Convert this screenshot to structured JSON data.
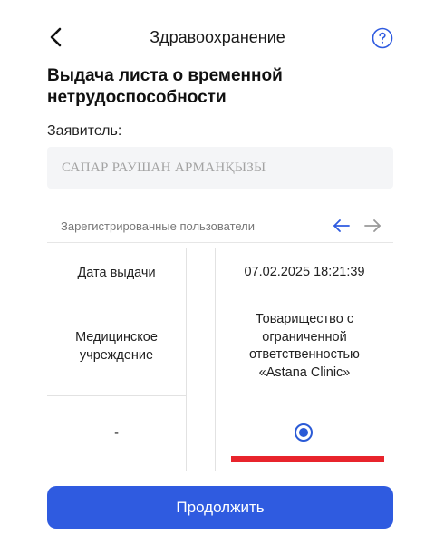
{
  "header": {
    "title": "Здравоохранение"
  },
  "page": {
    "title": "Выдача листа о временной нетрудоспособности"
  },
  "applicant": {
    "label": "Заявитель:",
    "value": "САПАР РАУШАН АРМАНҚЫЗЫ"
  },
  "registered_users": {
    "label": "Зарегистрированные пользователи"
  },
  "table": {
    "rows": [
      {
        "label": "Дата выдачи",
        "value": "07.02.2025 18:21:39"
      },
      {
        "label": "Медицинское учреждение",
        "value": "Товарищество с ограниченной ответственностью «Astana Clinic»"
      },
      {
        "label": "-",
        "value": ""
      }
    ],
    "selected": true
  },
  "actions": {
    "continue_label": "Продолжить"
  },
  "colors": {
    "accent": "#2f5be0",
    "radio": "#2a5ad6",
    "highlight_bar": "#e8242c",
    "field_bg": "#f4f5f7"
  },
  "icons": {
    "back": "chevron-left-icon",
    "help": "question-circle-icon",
    "prev": "arrow-left-icon",
    "next": "arrow-right-icon"
  }
}
